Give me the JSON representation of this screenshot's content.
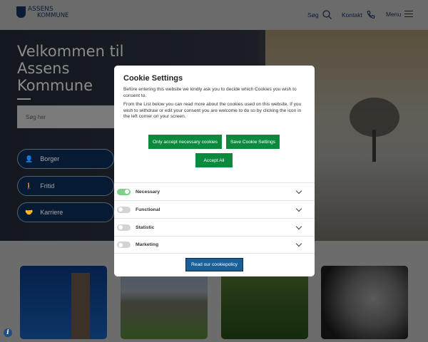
{
  "header": {
    "logo_line1": "ASSENS",
    "logo_line2": "KOMMUNE",
    "search_label": "Søg",
    "contact_label": "Kontakt",
    "menu_label": "Menu"
  },
  "hero": {
    "title": "Velkommen til Assens Kommune",
    "search_placeholder": "Søg her",
    "links": [
      {
        "label": "Borger"
      },
      {
        "label": "Fritid"
      },
      {
        "label": "Karriere"
      }
    ]
  },
  "cookie": {
    "title": "Cookie Settings",
    "intro": "Before entering this website we kindly ask you to decide which Cookies you wish to consent to.",
    "details": "From the List below you can read more about the cookies used on this website. If you wish to withdraw or edit your consent you are welcome to do so by clicking the icon in the left corner on your screen.",
    "btn_necessary": "Only accept necessary cookies",
    "btn_save": "Save Cookie Settings",
    "btn_accept": "Accept All",
    "categories": [
      {
        "label": "Necessary",
        "enabled": true
      },
      {
        "label": "Functional",
        "enabled": false
      },
      {
        "label": "Statistic",
        "enabled": false
      },
      {
        "label": "Marketing",
        "enabled": false
      }
    ],
    "policy_label": "Read our cookiepolicy"
  },
  "colors": {
    "primary": "#0c2d57",
    "green": "#0b8a3e",
    "policy": "#1a5f99"
  }
}
